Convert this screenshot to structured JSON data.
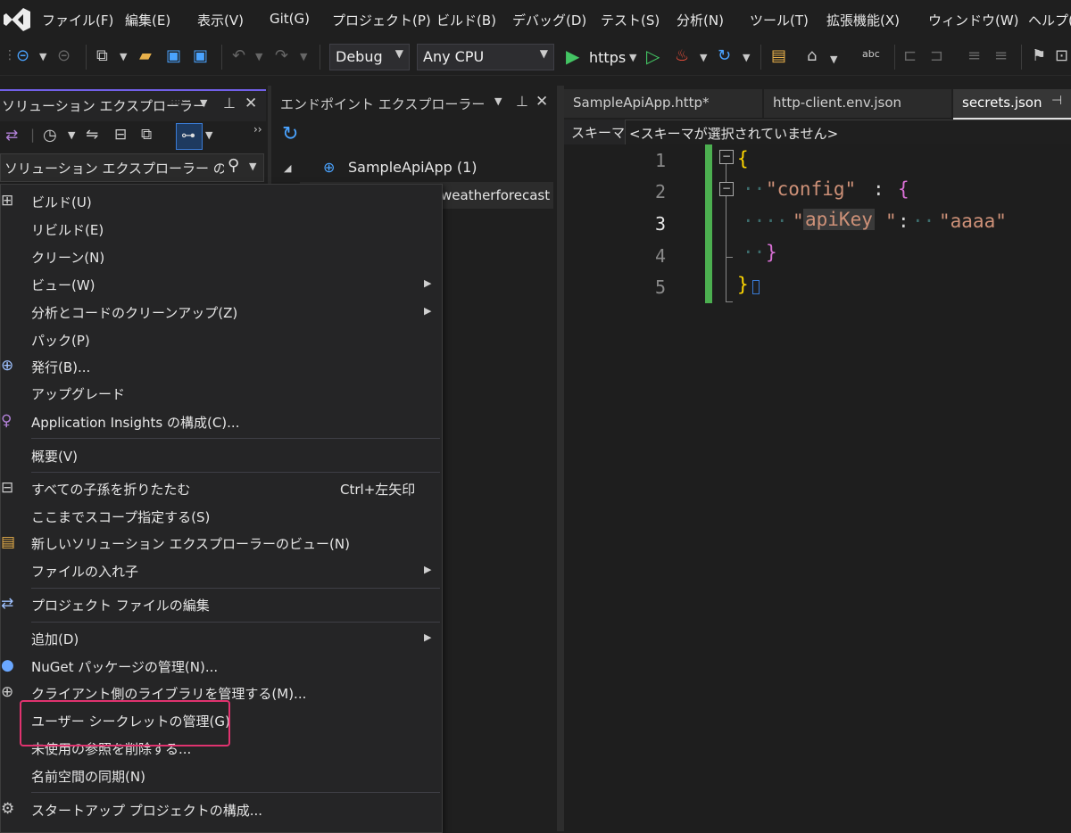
{
  "menubar": {
    "items": [
      "ファイル(F)",
      "編集(E)",
      "表示(V)",
      "Git(G)",
      "プロジェクト(P)",
      "ビルド(B)",
      "デバッグ(D)",
      "テスト(S)",
      "分析(N)",
      "ツール(T)",
      "拡張機能(X)",
      "ウィンドウ(W)",
      "ヘルプ("
    ]
  },
  "toolbar": {
    "configuration": "Debug",
    "platform": "Any CPU",
    "run_target": "https"
  },
  "solution_explorer": {
    "title": "ソリューション エクスプローラー",
    "search_placeholder": "ソリューション エクスプローラー の検索 ("
  },
  "endpoint_explorer": {
    "title": "エンドポイント エクスプローラー",
    "app_node": "SampleApiApp (1)",
    "endpoint_partial": "weatherforecast"
  },
  "editor": {
    "tabs": [
      "SampleApiApp.http*",
      "http-client.env.json",
      "secrets.json"
    ],
    "schema_label": "スキーマ:",
    "schema_value": "<スキーマが選択されていません>",
    "line_numbers": [
      "1",
      "2",
      "3",
      "4",
      "5"
    ],
    "tokens": {
      "open_brace": "{",
      "config_key": "\"config\"",
      "colon": ":",
      "inner_open": "{",
      "q": "\"",
      "apikey": "apiKey",
      "apikey_value": "\"aaaa\"",
      "inner_close": "}",
      "close_brace": "}"
    }
  },
  "context_menu": {
    "items": [
      {
        "label": "ビルド(U)"
      },
      {
        "label": "リビルド(E)"
      },
      {
        "label": "クリーン(N)"
      },
      {
        "label": "ビュー(W)"
      },
      {
        "label": "分析とコードのクリーンアップ(Z)"
      },
      {
        "label": "パック(P)"
      },
      {
        "label": "発行(B)..."
      },
      {
        "label": "アップグレード"
      },
      {
        "label": "Application Insights の構成(C)..."
      },
      {
        "label": "概要(V)"
      },
      {
        "label": "すべての子孫を折りたたむ",
        "shortcut": "Ctrl+左矢印"
      },
      {
        "label": "ここまでスコープ指定する(S)"
      },
      {
        "label": "新しいソリューション エクスプローラーのビュー(N)"
      },
      {
        "label": "ファイルの入れ子"
      },
      {
        "label": "プロジェクト ファイルの編集"
      },
      {
        "label": "追加(D)"
      },
      {
        "label": "NuGet パッケージの管理(N)..."
      },
      {
        "label": "クライアント側のライブラリを管理する(M)..."
      },
      {
        "label": "ユーザー シークレットの管理(G)"
      },
      {
        "label": "未使用の参照を削除する..."
      },
      {
        "label": "名前空間の同期(N)"
      },
      {
        "label": "スタートアップ プロジェクトの構成..."
      }
    ]
  },
  "colors": {
    "accent": "#7160e8",
    "highlight": "#e0336f",
    "json_key": "#ce9178",
    "change_bar": "#4caf50"
  }
}
